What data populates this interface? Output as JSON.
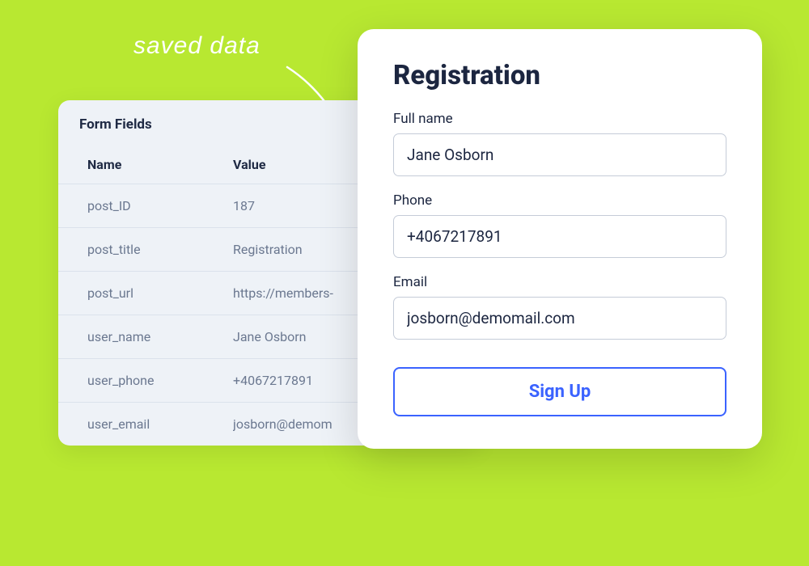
{
  "annotation": {
    "label": "saved data"
  },
  "table": {
    "title": "Form Fields",
    "headers": {
      "name": "Name",
      "value": "Value"
    },
    "rows": [
      {
        "name": "post_ID",
        "value": "187"
      },
      {
        "name": "post_title",
        "value": "Registration"
      },
      {
        "name": "post_url",
        "value": "https://members-"
      },
      {
        "name": "user_name",
        "value": "Jane Osborn"
      },
      {
        "name": "user_phone",
        "value": "+4067217891"
      },
      {
        "name": "user_email",
        "value": "josborn@demom"
      }
    ]
  },
  "form": {
    "title": "Registration",
    "full_name_label": "Full name",
    "full_name_value": "Jane Osborn",
    "phone_label": "Phone",
    "phone_value": "+4067217891",
    "email_label": "Email",
    "email_value": "josborn@demomail.com",
    "submit_label": "Sign Up"
  }
}
